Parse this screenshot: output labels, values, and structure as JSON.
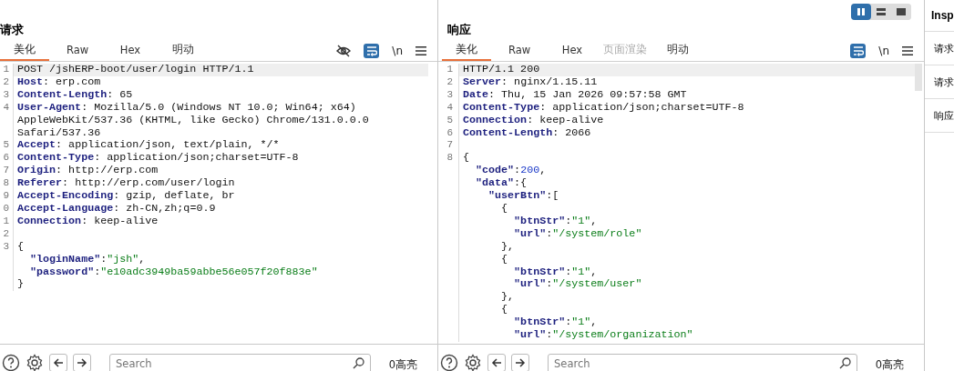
{
  "layout_toggle": [
    {
      "selected": true
    },
    {
      "selected": false
    },
    {
      "selected": false
    }
  ],
  "panes": [
    {
      "title": "请求",
      "tabs": [
        {
          "label": "美化",
          "selected": true,
          "disabled": false
        },
        {
          "label": "Raw",
          "selected": false,
          "disabled": false
        },
        {
          "label": "Hex",
          "selected": false,
          "disabled": false
        },
        {
          "label": "明动",
          "selected": false,
          "disabled": false
        }
      ],
      "tools": [
        {
          "kind": "hide"
        },
        {
          "kind": "wrap",
          "on": true
        },
        {
          "kind": "newline",
          "label": "\\n"
        },
        {
          "kind": "menu"
        }
      ],
      "rows": [
        {
          "number": "1",
          "current": true,
          "segments": [
            {
              "kind": "plain",
              "text": "POST /jshERP-boot/user/login HTTP/1.1"
            }
          ]
        },
        {
          "number": "2",
          "current": false,
          "segments": [
            {
              "kind": "name",
              "text": "Host"
            },
            {
              "kind": "plain",
              "text": ": erp.com"
            }
          ]
        },
        {
          "number": "3",
          "current": false,
          "segments": [
            {
              "kind": "name",
              "text": "Content-Length"
            },
            {
              "kind": "plain",
              "text": ": 65"
            }
          ]
        },
        {
          "number": "4",
          "current": false,
          "segments": [
            {
              "kind": "name",
              "text": "User-Agent"
            },
            {
              "kind": "plain",
              "text": ": Mozilla/5.0 (Windows NT 10.0; Win64; x64)"
            }
          ]
        },
        {
          "current": false,
          "segments": [
            {
              "kind": "plain",
              "text": "AppleWebKit/537.36 (KHTML, like Gecko) Chrome/131.0.0.0"
            }
          ]
        },
        {
          "current": false,
          "segments": [
            {
              "kind": "plain",
              "text": "Safari/537.36"
            }
          ]
        },
        {
          "number": "5",
          "current": false,
          "segments": [
            {
              "kind": "name",
              "text": "Accept"
            },
            {
              "kind": "plain",
              "text": ": application/json, text/plain, */*"
            }
          ]
        },
        {
          "number": "6",
          "current": false,
          "segments": [
            {
              "kind": "name",
              "text": "Content-Type"
            },
            {
              "kind": "plain",
              "text": ": application/json;charset=UTF-8"
            }
          ]
        },
        {
          "number": "7",
          "current": false,
          "segments": [
            {
              "kind": "name",
              "text": "Origin"
            },
            {
              "kind": "plain",
              "text": ": http://erp.com"
            }
          ]
        },
        {
          "number": "8",
          "current": false,
          "segments": [
            {
              "kind": "name",
              "text": "Referer"
            },
            {
              "kind": "plain",
              "text": ": http://erp.com/user/login"
            }
          ]
        },
        {
          "number": "9",
          "current": false,
          "segments": [
            {
              "kind": "name",
              "text": "Accept-Encoding"
            },
            {
              "kind": "plain",
              "text": ": gzip, deflate, br"
            }
          ]
        },
        {
          "number": "0",
          "current": false,
          "segments": [
            {
              "kind": "name",
              "text": "Accept-Language"
            },
            {
              "kind": "plain",
              "text": ": zh-CN,zh;q=0.9"
            }
          ]
        },
        {
          "number": "1",
          "current": false,
          "segments": [
            {
              "kind": "name",
              "text": "Connection"
            },
            {
              "kind": "plain",
              "text": ": keep-alive"
            }
          ]
        },
        {
          "number": "2",
          "current": false
        },
        {
          "number": "3",
          "current": false,
          "segments": [
            {
              "kind": "plain",
              "text": "{"
            }
          ]
        },
        {
          "current": false,
          "segments": [
            {
              "kind": "key",
              "text": "  \"loginName\""
            },
            {
              "kind": "plain",
              "text": ":"
            },
            {
              "kind": "string",
              "text": "\"jsh\""
            },
            {
              "kind": "plain",
              "text": ","
            }
          ]
        },
        {
          "current": false,
          "segments": [
            {
              "kind": "key",
              "text": "  \"password\""
            },
            {
              "kind": "plain",
              "text": ":"
            },
            {
              "kind": "string",
              "text": "\"e10adc3949ba59abbe56e057f20f883e\""
            }
          ]
        },
        {
          "current": false,
          "segments": [
            {
              "kind": "plain",
              "text": "}"
            }
          ]
        }
      ],
      "search": {
        "placeholder": "Search"
      },
      "highlights": "0高亮"
    },
    {
      "title": "响应",
      "tabs": [
        {
          "label": "美化",
          "selected": true,
          "disabled": false
        },
        {
          "label": "Raw",
          "selected": false,
          "disabled": false
        },
        {
          "label": "Hex",
          "selected": false,
          "disabled": false
        },
        {
          "label": "页面渲染",
          "selected": false,
          "disabled": true
        },
        {
          "label": "明动",
          "selected": false,
          "disabled": false
        }
      ],
      "tools": [
        {
          "kind": "wrap",
          "on": true
        },
        {
          "kind": "newline",
          "label": "\\n"
        },
        {
          "kind": "menu"
        }
      ],
      "rows": [
        {
          "number": "1",
          "current": true,
          "segments": [
            {
              "kind": "plain",
              "text": "HTTP/1.1 200"
            }
          ]
        },
        {
          "number": "2",
          "current": false,
          "segments": [
            {
              "kind": "name",
              "text": "Server"
            },
            {
              "kind": "plain",
              "text": ": nginx/1.15.11"
            }
          ]
        },
        {
          "number": "3",
          "current": false,
          "segments": [
            {
              "kind": "name",
              "text": "Date"
            },
            {
              "kind": "plain",
              "text": ": Thu, 15 Jan 2026 09:57:58 GMT"
            }
          ]
        },
        {
          "number": "4",
          "current": false,
          "segments": [
            {
              "kind": "name",
              "text": "Content-Type"
            },
            {
              "kind": "plain",
              "text": ": application/json;charset=UTF-8"
            }
          ]
        },
        {
          "number": "5",
          "current": false,
          "segments": [
            {
              "kind": "name",
              "text": "Connection"
            },
            {
              "kind": "plain",
              "text": ": keep-alive"
            }
          ]
        },
        {
          "number": "6",
          "current": false,
          "segments": [
            {
              "kind": "name",
              "text": "Content-Length"
            },
            {
              "kind": "plain",
              "text": ": 2066"
            }
          ]
        },
        {
          "number": "7",
          "current": false
        },
        {
          "number": "8",
          "current": false,
          "segments": [
            {
              "kind": "plain",
              "text": "{"
            }
          ]
        },
        {
          "current": false,
          "segments": [
            {
              "kind": "key",
              "text": "  \"code\""
            },
            {
              "kind": "plain",
              "text": ":"
            },
            {
              "kind": "number",
              "text": "200"
            },
            {
              "kind": "plain",
              "text": ","
            }
          ]
        },
        {
          "current": false,
          "segments": [
            {
              "kind": "key",
              "text": "  \"data\""
            },
            {
              "kind": "plain",
              "text": ":{"
            }
          ]
        },
        {
          "current": false,
          "segments": [
            {
              "kind": "key",
              "text": "    \"userBtn\""
            },
            {
              "kind": "plain",
              "text": ":["
            }
          ]
        },
        {
          "current": false,
          "segments": [
            {
              "kind": "plain",
              "text": "      {"
            }
          ]
        },
        {
          "current": false,
          "segments": [
            {
              "kind": "key",
              "text": "        \"btnStr\""
            },
            {
              "kind": "plain",
              "text": ":"
            },
            {
              "kind": "string",
              "text": "\"1\""
            },
            {
              "kind": "plain",
              "text": ","
            }
          ]
        },
        {
          "current": false,
          "segments": [
            {
              "kind": "key",
              "text": "        \"url\""
            },
            {
              "kind": "plain",
              "text": ":"
            },
            {
              "kind": "string",
              "text": "\"/system/role\""
            }
          ]
        },
        {
          "current": false,
          "segments": [
            {
              "kind": "plain",
              "text": "      },"
            }
          ]
        },
        {
          "current": false,
          "segments": [
            {
              "kind": "plain",
              "text": "      {"
            }
          ]
        },
        {
          "current": false,
          "segments": [
            {
              "kind": "key",
              "text": "        \"btnStr\""
            },
            {
              "kind": "plain",
              "text": ":"
            },
            {
              "kind": "string",
              "text": "\"1\""
            },
            {
              "kind": "plain",
              "text": ","
            }
          ]
        },
        {
          "current": false,
          "segments": [
            {
              "kind": "key",
              "text": "        \"url\""
            },
            {
              "kind": "plain",
              "text": ":"
            },
            {
              "kind": "string",
              "text": "\"/system/user\""
            }
          ]
        },
        {
          "current": false,
          "segments": [
            {
              "kind": "plain",
              "text": "      },"
            }
          ]
        },
        {
          "current": false,
          "segments": [
            {
              "kind": "plain",
              "text": "      {"
            }
          ]
        },
        {
          "current": false,
          "segments": [
            {
              "kind": "key",
              "text": "        \"btnStr\""
            },
            {
              "kind": "plain",
              "text": ":"
            },
            {
              "kind": "string",
              "text": "\"1\""
            },
            {
              "kind": "plain",
              "text": ","
            }
          ]
        },
        {
          "current": false,
          "segments": [
            {
              "kind": "key",
              "text": "        \"url\""
            },
            {
              "kind": "plain",
              "text": ":"
            },
            {
              "kind": "string",
              "text": "\"/system/organization\""
            }
          ]
        }
      ],
      "search": {
        "placeholder": "Search"
      },
      "highlights": "0高亮"
    }
  ],
  "inspector": {
    "title": "Insp",
    "items": [
      "请求",
      "请求",
      "响应"
    ]
  }
}
